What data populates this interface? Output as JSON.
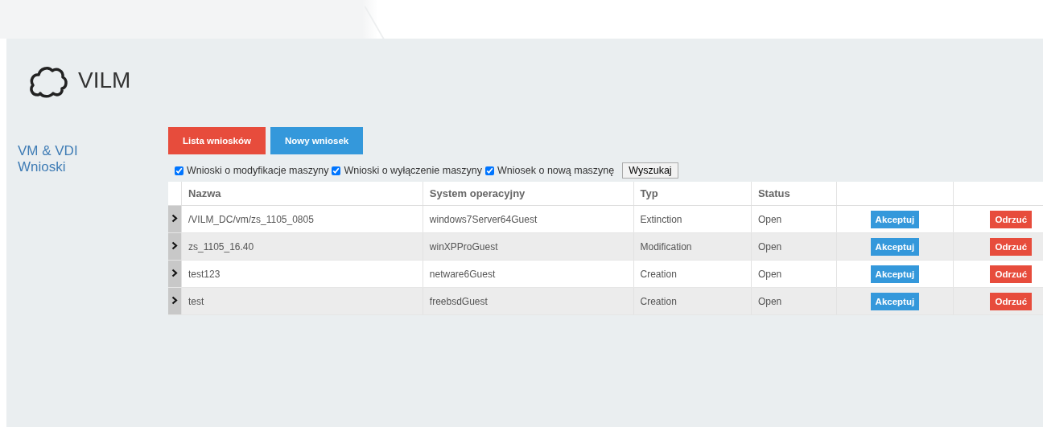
{
  "app": {
    "title": "VILM"
  },
  "sidebar": {
    "items": [
      {
        "label": "VM & VDI"
      },
      {
        "label": "Wnioski"
      }
    ]
  },
  "tabs": [
    {
      "label": "Lista wniosków",
      "selected": true
    },
    {
      "label": "Nowy wniosek",
      "selected": false
    }
  ],
  "filters": [
    {
      "label": "Wnioski o modyfikacje maszyny",
      "checked": true
    },
    {
      "label": "Wnioski o wyłączenie maszyny",
      "checked": true
    },
    {
      "label": "Wniosek o nową maszynę",
      "checked": true
    }
  ],
  "search_button": "Wyszukaj",
  "table": {
    "columns": [
      "Nazwa",
      "System operacyjny",
      "Typ",
      "Status"
    ],
    "rows": [
      {
        "name": "/VILM_DC/vm/zs_1105_0805",
        "os": "windows7Server64Guest",
        "type": "Extinction",
        "status": "Open",
        "accept": "Akceptuj",
        "reject": "Odrzuć",
        "expanded": false
      },
      {
        "name": "zs_1105_16.40",
        "os": "winXPProGuest",
        "type": "Modification",
        "status": "Open",
        "accept": "Akceptuj",
        "reject": "Odrzuć",
        "expanded": false
      },
      {
        "name": "test123",
        "os": "netware6Guest",
        "type": "Creation",
        "status": "Open",
        "accept": "Akceptuj",
        "reject": "Odrzuć",
        "expanded": false
      },
      {
        "name": "test",
        "os": "freebsdGuest",
        "type": "Creation",
        "status": "Open",
        "accept": "Akceptuj",
        "reject": "Odrzuć",
        "expanded": false
      }
    ]
  }
}
